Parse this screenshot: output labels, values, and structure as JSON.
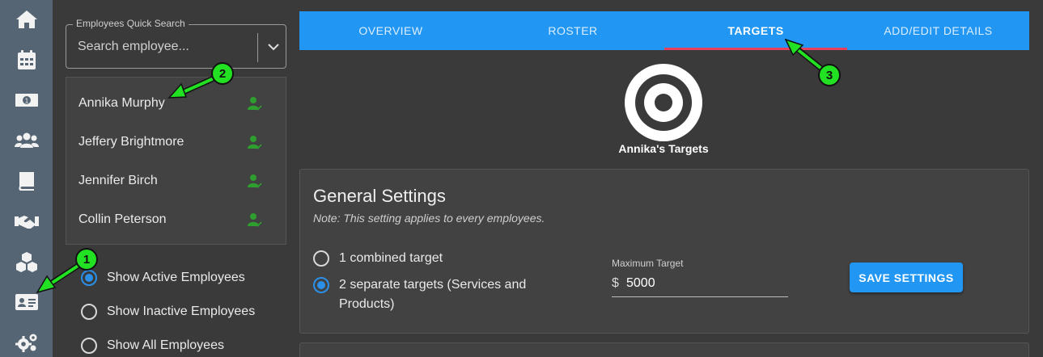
{
  "rail": {
    "items": [
      {
        "icon": "home-icon"
      },
      {
        "icon": "calendar-icon"
      },
      {
        "icon": "money-icon"
      },
      {
        "icon": "users-icon"
      },
      {
        "icon": "book-icon"
      },
      {
        "icon": "handshake-icon"
      },
      {
        "icon": "boxes-icon"
      },
      {
        "icon": "id-card-icon"
      },
      {
        "icon": "gears-icon"
      }
    ]
  },
  "search": {
    "legend": "Employees Quick Search",
    "placeholder": "Search employee..."
  },
  "employees": [
    {
      "name": "Annika Murphy"
    },
    {
      "name": "Jeffery Brightmore"
    },
    {
      "name": "Jennifer Birch"
    },
    {
      "name": "Collin Peterson"
    }
  ],
  "filters": [
    {
      "label": "Show Active Employees",
      "selected": true
    },
    {
      "label": "Show Inactive Employees",
      "selected": false
    },
    {
      "label": "Show All Employees",
      "selected": false
    }
  ],
  "tabs": [
    {
      "label": "OVERVIEW",
      "active": false
    },
    {
      "label": "ROSTER",
      "active": false
    },
    {
      "label": "TARGETS",
      "active": true
    },
    {
      "label": "ADD/EDIT DETAILS",
      "active": false
    }
  ],
  "targets": {
    "title": "Annika's Targets"
  },
  "settings": {
    "title": "General Settings",
    "note": "Note: This setting applies to every employees.",
    "option1": "1 combined target",
    "option2_line1": "2 separate targets (Services and",
    "option2_line2": "Products)",
    "selected_option": 2,
    "max_label": "Maximum Target",
    "max_prefix": "$",
    "max_value": "5000",
    "save_label": "SAVE SETTINGS"
  },
  "annotations": {
    "badge1": "1",
    "badge2": "2",
    "badge3": "3"
  },
  "colors": {
    "accent": "#2196f3",
    "indicator": "#e8405c",
    "rail": "#566573",
    "annotation": "#22e022",
    "employee_icon": "#2e9e2e"
  }
}
